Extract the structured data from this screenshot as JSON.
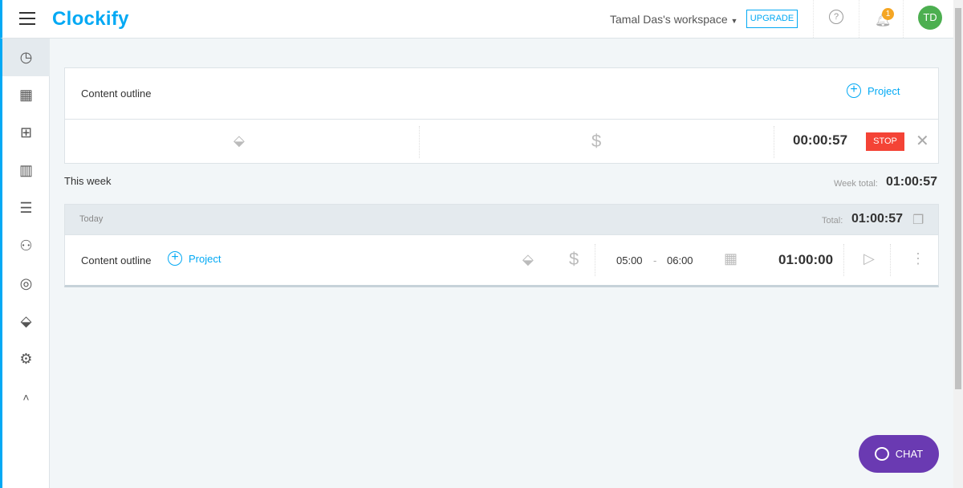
{
  "header": {
    "logo": "Clockify",
    "workspace": "Tamal Das's workspace",
    "upgrade": "UPGRADE",
    "help": "?",
    "notification_count": "1",
    "avatar_initials": "TD"
  },
  "sidebar": {
    "items": [
      {
        "icon": "clock-icon",
        "glyph": "◷"
      },
      {
        "icon": "calendar-icon",
        "glyph": "▦"
      },
      {
        "icon": "dashboard-icon",
        "glyph": "⊞"
      },
      {
        "icon": "reports-icon",
        "glyph": "▥"
      },
      {
        "icon": "document-icon",
        "glyph": "☰"
      },
      {
        "icon": "team-icon",
        "glyph": "⚇"
      },
      {
        "icon": "client-icon",
        "glyph": "◎"
      },
      {
        "icon": "tag-icon",
        "glyph": "⬙"
      },
      {
        "icon": "settings-icon",
        "glyph": "⚙"
      },
      {
        "icon": "chevron-up-icon",
        "glyph": "˄"
      }
    ]
  },
  "tracker": {
    "description": "Content outline",
    "project": "Project",
    "plus": "+",
    "tag": "⬙",
    "billable": "$",
    "time": "00:00:57",
    "stop": "STOP",
    "close": "✕"
  },
  "week": {
    "label": "This week",
    "total_label": "Week total:",
    "total": "01:00:57"
  },
  "day": {
    "label": "Today",
    "total_label": "Total:",
    "total": "01:00:57",
    "entry": {
      "description": "Content outline",
      "project": "Project",
      "plus": "+",
      "tag": "⬙",
      "billable": "$",
      "start": "05:00",
      "dash": "-",
      "end": "06:00",
      "calendar": "▦",
      "duration": "01:00:00",
      "play": "▷",
      "more": "⋮"
    }
  },
  "chat": {
    "label": "CHAT"
  },
  "colors": {
    "brand": "#03a9f4",
    "stop": "#f44336",
    "chat": "#6a3ab2",
    "avatar": "#4caf50",
    "badge": "#f5a623"
  }
}
